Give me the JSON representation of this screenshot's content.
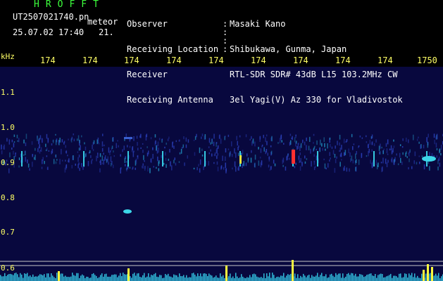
{
  "header": {
    "title": "HROFFT",
    "filename": "UT2507021740.pn",
    "detection_label": "meteor",
    "datetime": "25.07.02 17:40",
    "count": "21.",
    "info": [
      {
        "label": "Observer",
        "value": "Masaki Kano"
      },
      {
        "label": "Receiving Location",
        "value": "Shibukawa, Gunma, Japan"
      },
      {
        "label": "Receiver",
        "value": "RTL-SDR SDR# 43dB L15 103.2MHz CW"
      },
      {
        "label": "Receiving Antenna",
        "value": "3el Yagi(V) Az 330 for Vladivostok"
      }
    ]
  },
  "axes": {
    "x_ticks": [
      "174",
      "174",
      "174",
      "174",
      "174",
      "174",
      "174",
      "174",
      "174",
      "1750"
    ],
    "y_unit": "kHz",
    "y_ticks": [
      "1.1",
      "1.0",
      "0.9",
      "0.8",
      "0.7",
      "0.6"
    ]
  },
  "colors": {
    "background": "#000000",
    "plot_background": "#08083e",
    "title": "#3cff3c",
    "text": "#ffffff",
    "axis_labels": "#ffff66"
  }
}
